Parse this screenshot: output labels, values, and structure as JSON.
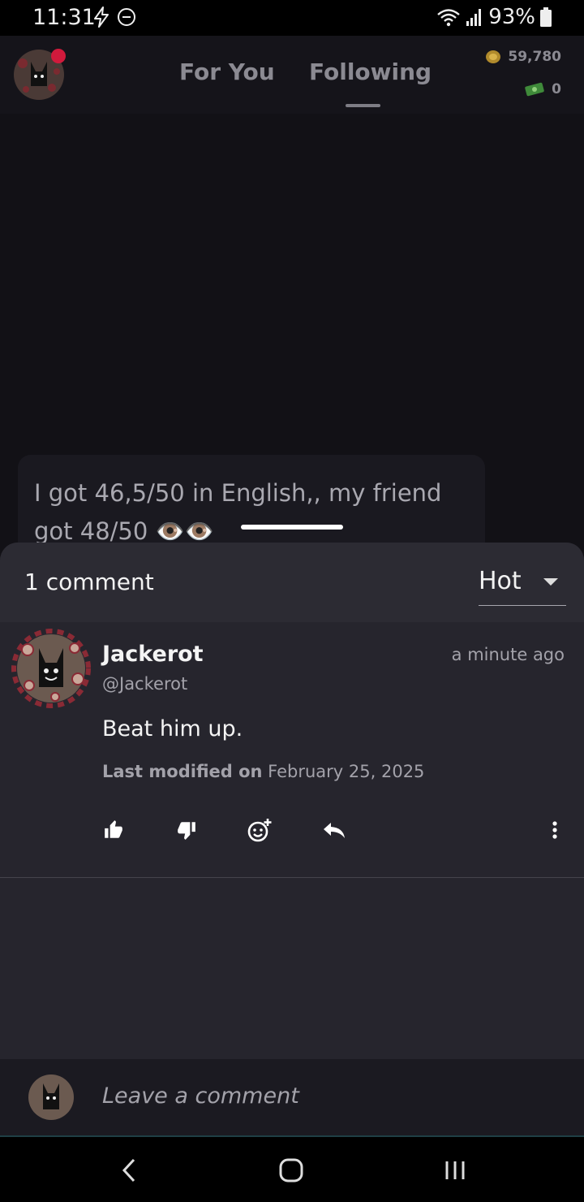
{
  "status_bar": {
    "time": "11:31",
    "battery": "93%"
  },
  "header": {
    "tabs": [
      {
        "label": "For You",
        "active": false
      },
      {
        "label": "Following",
        "active": true
      }
    ],
    "wallet": {
      "coins": "59,780",
      "cash": "0"
    }
  },
  "post": {
    "text": "I got 46,5/50 in English,, my friend got 48/50 👁️👁️"
  },
  "comments_sheet": {
    "count_label": "1 comment",
    "sort_value": "Hot",
    "comments": [
      {
        "author": "Jackerot",
        "handle": "@Jackerot",
        "time": "a minute ago",
        "body": "Beat him up.",
        "modified_label": "Last modified on",
        "modified_date": "February 25, 2025"
      }
    ]
  },
  "comment_input": {
    "placeholder": "Leave a comment"
  },
  "colors": {
    "background": "#121116",
    "sheet": "#26252d",
    "notification_dot": "#d11a3c",
    "accent_text": "#f4f4f4",
    "muted_text": "#a3a2aa"
  }
}
